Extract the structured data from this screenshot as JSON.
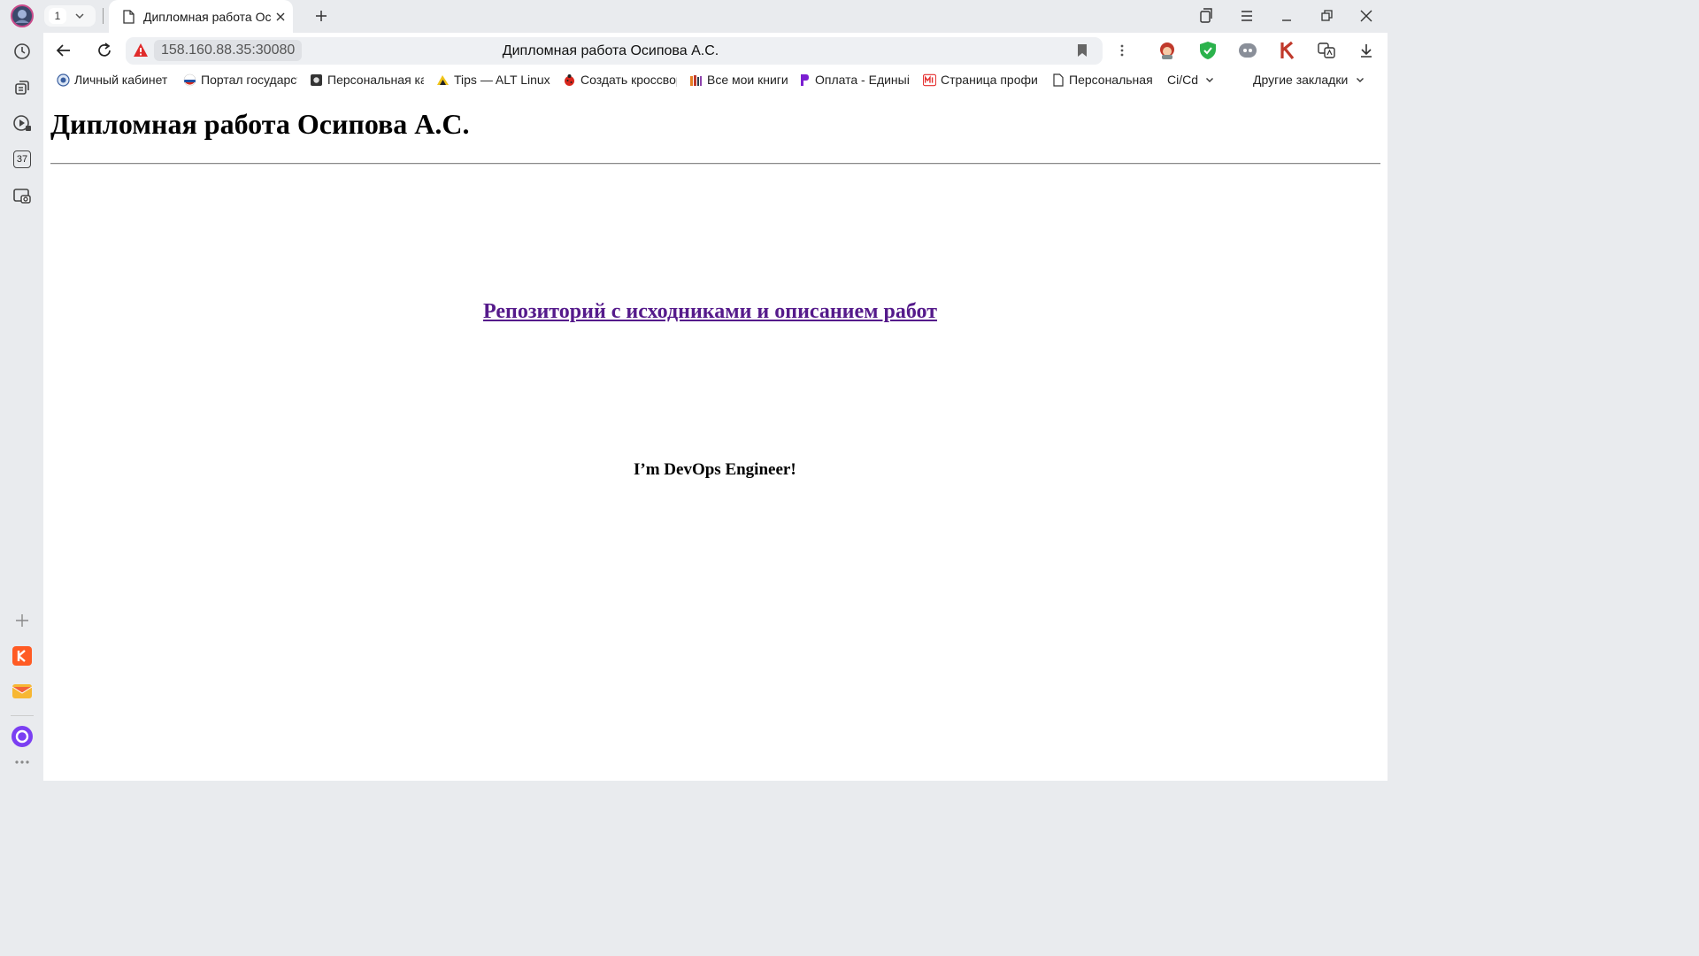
{
  "browser": {
    "tab_count": "1",
    "active_tab_title": "Дипломная работа Осипова А.С.",
    "url": "158.160.88.35:30080",
    "omnibox_title": "Дипломная работа Осипова А.С.",
    "sidebar_badge": "37",
    "bookmarks": [
      {
        "label": "Личный кабинет налогоплательщика",
        "icon": "tax-service-icon"
      },
      {
        "label": "Портал государственных услуг",
        "icon": "russia-flag-icon"
      },
      {
        "label": "Персональная карта",
        "icon": "photo-icon"
      },
      {
        "label": "Tips — ALT Linux Wiki",
        "icon": "alt-linux-icon"
      },
      {
        "label": "Создать кроссворд",
        "icon": "ladybug-icon"
      },
      {
        "label": "Все мои книги",
        "icon": "books-icon"
      },
      {
        "label": "Оплата - Единый",
        "icon": "payment-icon"
      },
      {
        "label": "Страница профиля",
        "icon": "m-logo-icon"
      },
      {
        "label": "Персональная страница",
        "icon": "page-icon"
      }
    ],
    "bookmark_folder": "Ci/Cd",
    "other_bookmarks": "Другие закладки",
    "colors": {
      "accent_link": "#551a8b",
      "shield_green": "#2bb24c",
      "kinopoisk_red": "#ff5b24",
      "alice_purple": "#7b3ff2"
    }
  },
  "page": {
    "title": "Дипломная работа Осипова А.С.",
    "repo_link": "Репозиторий с исходниками и описанием работ",
    "tagline": "I’m DevOps Engineer!"
  }
}
